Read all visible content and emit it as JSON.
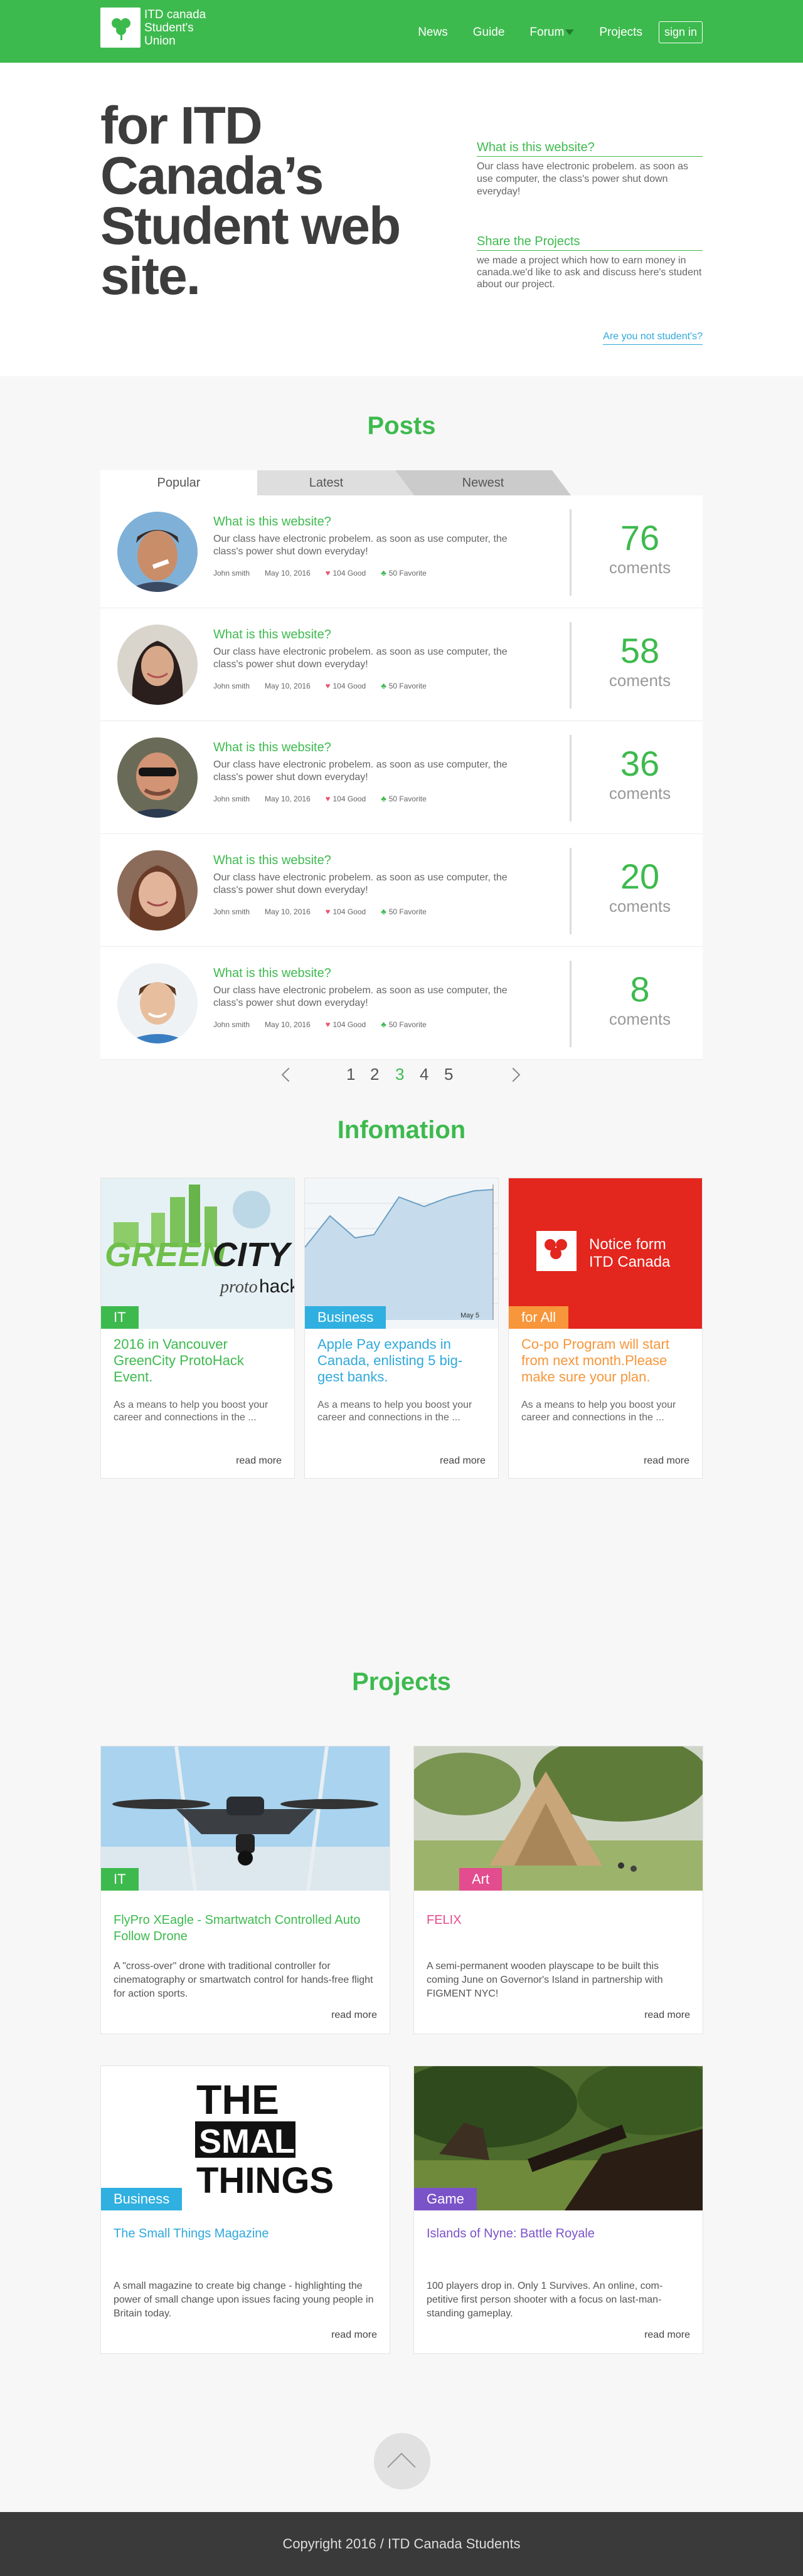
{
  "header": {
    "logo_text": "ITD canada Student's Union",
    "nav": [
      "News",
      "Guide",
      "Forum",
      "Projects"
    ],
    "signin_label": "sign in"
  },
  "hero": {
    "title": "for ITD Canada’s Student web site.",
    "blocks": [
      {
        "link": "What is this website?",
        "text": "Our class have electronic probelem. as soon as use computer, the class's power shut down everyday!"
      },
      {
        "link": "Share the Projects",
        "text": "we made a project which how to earn money in canada.we'd like to ask and discuss here's student about our project."
      }
    ],
    "not_student_link": "Are you not student's?"
  },
  "posts": {
    "title": "Posts",
    "tabs": [
      "Popular",
      "Latest",
      "Newest"
    ],
    "items": [
      {
        "title": "What is this website?",
        "body": "Our class have electronic probelem. as soon as use computer, the class's power shut down everyday!",
        "author": "John smith",
        "date": "May 10, 2016",
        "good": "104 Good",
        "favorite": "50 Favorite",
        "count": "76",
        "unit": "coments"
      },
      {
        "title": "What is this website?",
        "body": "Our class have electronic probelem. as soon as use computer, the class's power shut down everyday!",
        "author": "John smith",
        "date": "May 10, 2016",
        "good": "104 Good",
        "favorite": "50 Favorite",
        "count": "58",
        "unit": "coments"
      },
      {
        "title": "What is this website?",
        "body": "Our class have electronic probelem. as soon as use computer, the class's power shut down everyday!",
        "author": "John smith",
        "date": "May 10, 2016",
        "good": "104 Good",
        "favorite": "50 Favorite",
        "count": "36",
        "unit": "coments"
      },
      {
        "title": "What is this website?",
        "body": "Our class have electronic probelem. as soon as use computer, the class's power shut down everyday!",
        "author": "John smith",
        "date": "May 10, 2016",
        "good": "104 Good",
        "favorite": "50 Favorite",
        "count": "20",
        "unit": "coments"
      },
      {
        "title": "What is this website?",
        "body": "Our class have electronic probelem. as soon as use computer, the class's power shut down everyday!",
        "author": "John smith",
        "date": "May 10, 2016",
        "good": "104 Good",
        "favorite": "50 Favorite",
        "count": "8",
        "unit": "coments"
      }
    ],
    "pages": [
      "1",
      "2",
      "3",
      "4",
      "5"
    ],
    "current_page": "3"
  },
  "info": {
    "title": "Infomation",
    "cards": [
      {
        "tag": "IT",
        "tag_color": "#3dba4e",
        "title": "2016 in Vancouver GreenCity ProtoHack Event.",
        "title_color": "#3dba4e",
        "body": "As a means to help you boost your career and connections in the ...",
        "readmore": "read more",
        "img_text_1": "GREEN",
        "img_text_2": "CITY",
        "img_text_3": "proto",
        "img_text_4": "hack"
      },
      {
        "tag": "Business",
        "tag_color": "#2fb0e0",
        "title": "Apple Pay expands in Canada, enlisting 5 big-gest banks.",
        "title_color": "#2fa8dc",
        "body": "As a means to help you boost your career and connections in the ...",
        "readmore": "read more",
        "img_text_1": "May 5"
      },
      {
        "tag": "for All",
        "tag_color": "#f7963a",
        "title": "Co-po Program will start from next month.Please make sure your plan.",
        "title_color": "#f7963a",
        "body": "As a means to help you boost your career and connections in the ...",
        "readmore": "read more",
        "img_text_1": "Notice form ITD Canada"
      }
    ]
  },
  "projects": {
    "title": "Projects",
    "cards": [
      {
        "tag": "IT",
        "tag_color": "#3dba4e",
        "title": "FlyPro XEagle - Smartwatch Controlled Auto Follow Drone",
        "title_color": "#3dba4e",
        "body": "A \"cross-over\" drone with traditional controller for cinematography or smartwatch control for hands-free flight for action sports.",
        "readmore": "read more"
      },
      {
        "tag": "Art",
        "tag_color": "#e34c8e",
        "title": "FELIX",
        "title_color": "#e34c8e",
        "body": "A semi-permanent wooden playscape to be built this coming June on Governor's Island in partnership with FIGMENT NYC!",
        "readmore": "read more"
      },
      {
        "tag": "Business",
        "tag_color": "#2fb0e0",
        "title": "The Small Things Magazine",
        "title_color": "#2fa8dc",
        "body": "A small magazine to create big change - highlighting the power of small change upon issues facing young people in Britain today.",
        "readmore": "read more",
        "img_text_1": "THE",
        "img_text_2": "SMALL",
        "img_text_3": "THINGS"
      },
      {
        "tag": "Game",
        "tag_color": "#7b53c8",
        "title": "Islands of Nyne: Battle Royale",
        "title_color": "#7b53c8",
        "body": "100 players drop in. Only 1 Survives. An online, com-petitive first person shooter with a focus on last-man-standing gameplay.",
        "readmore": "read more"
      }
    ]
  },
  "footer": {
    "text": "Copyright 2016 / ITD Canada Students"
  }
}
